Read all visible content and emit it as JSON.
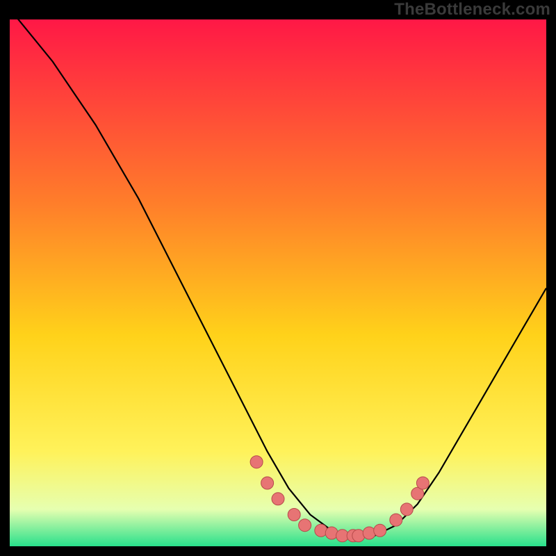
{
  "watermark": "TheBottleneck.com",
  "colors": {
    "frame": "#000000",
    "watermark_text": "#3a3a3a",
    "gradient_top": "#ff1846",
    "gradient_mid1": "#ff7e2a",
    "gradient_mid2": "#ffd21a",
    "gradient_mid3": "#fff25a",
    "gradient_mid4": "#e6ffb0",
    "gradient_bottom": "#28e08b",
    "curve": "#000000",
    "marker_fill": "#e77474",
    "marker_stroke": "#b54a4a"
  },
  "chart_data": {
    "type": "line",
    "title": "",
    "xlabel": "",
    "ylabel": "",
    "xlim": [
      0,
      100
    ],
    "ylim": [
      0,
      100
    ],
    "series": [
      {
        "name": "bottleneck-curve",
        "x": [
          0,
          4,
          8,
          12,
          16,
          20,
          24,
          28,
          32,
          36,
          40,
          44,
          48,
          52,
          56,
          60,
          64,
          68,
          72,
          76,
          80,
          84,
          88,
          92,
          96,
          100
        ],
        "y": [
          102,
          97,
          92,
          86,
          80,
          73,
          66,
          58,
          50,
          42,
          34,
          26,
          18,
          11,
          6,
          3,
          2,
          2,
          4,
          8,
          14,
          21,
          28,
          35,
          42,
          49
        ]
      }
    ],
    "markers": {
      "name": "highlighted-points",
      "x": [
        46,
        48,
        50,
        53,
        55,
        58,
        60,
        62,
        64,
        65,
        67,
        69,
        72,
        74,
        76,
        77
      ],
      "y": [
        16,
        12,
        9,
        6,
        4,
        3,
        2.5,
        2,
        2,
        2,
        2.5,
        3,
        5,
        7,
        10,
        12
      ]
    }
  }
}
